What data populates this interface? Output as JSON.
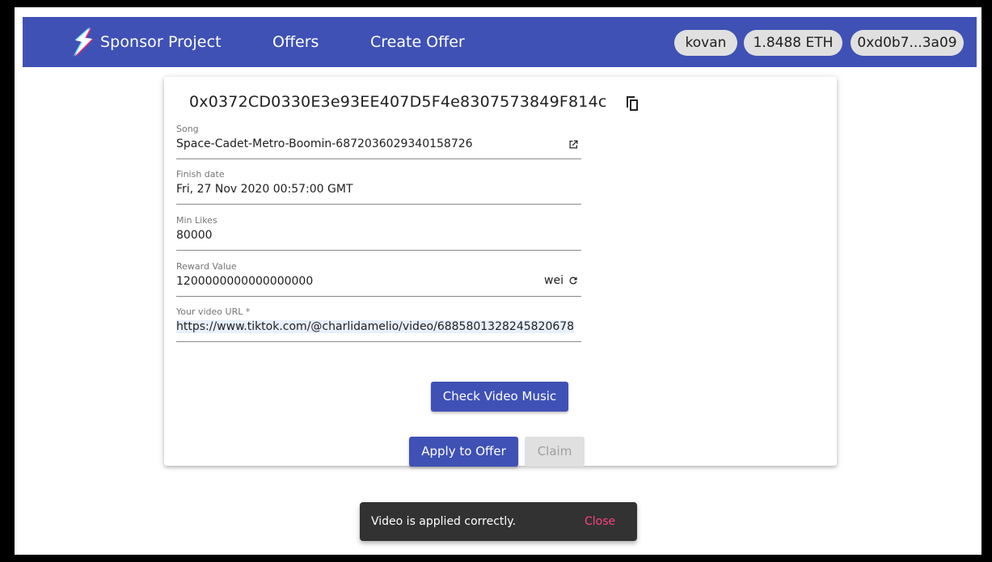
{
  "appbar": {
    "brand": "Sponsor Project",
    "nav": {
      "offers": "Offers",
      "create_offer": "Create Offer"
    },
    "network": "kovan",
    "balance": "1.8488 ETH",
    "account": "0xd0b7...3a09",
    "color": "#3f51b5"
  },
  "offer": {
    "address": "0x0372CD0330E3e93EE407D5F4e8307573849F814c",
    "copy_icon": "copy-icon",
    "fields": {
      "song": {
        "label": "Song",
        "value": "Space-Cadet-Metro-Boomin-6872036029340158726",
        "icon": "open-in-new-icon"
      },
      "finish_date": {
        "label": "Finish date",
        "value": "Fri, 27 Nov 2020 00:57:00 GMT"
      },
      "min_likes": {
        "label": "Min Likes",
        "value": "80000"
      },
      "reward": {
        "label": "Reward Value",
        "value": "1200000000000000000",
        "unit": "wei",
        "icon": "refresh-icon"
      },
      "video_url": {
        "label": "Your video URL *",
        "value": "https://www.tiktok.com/@charlidamelio/video/6885801328245820678"
      }
    },
    "buttons": {
      "check_music": "Check Video Music",
      "apply": "Apply to Offer",
      "claim": "Claim"
    }
  },
  "snackbar": {
    "message": "Video is applied correctly.",
    "action": "Close",
    "action_color": "#ff4081"
  }
}
